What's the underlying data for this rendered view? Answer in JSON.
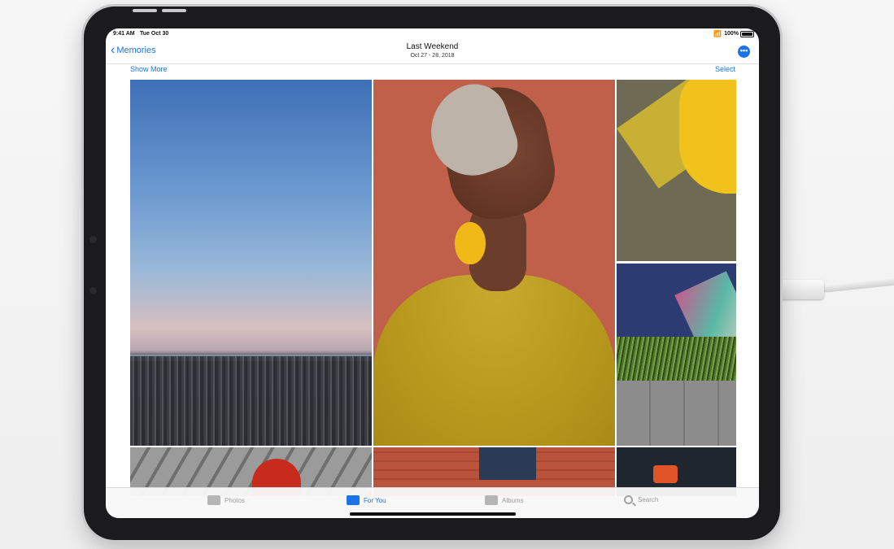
{
  "status_bar": {
    "time": "9:41 AM",
    "date": "Tue Oct 30",
    "battery": "100%"
  },
  "nav": {
    "back_label": "Memories",
    "title": "Last Weekend",
    "subtitle": "Oct 27 - 28, 2018",
    "more_icon": "ellipsis-icon"
  },
  "toolbar": {
    "show_more": "Show More",
    "select": "Select"
  },
  "tabs": [
    {
      "label": "Photos",
      "icon": "photos-icon",
      "active": false
    },
    {
      "label": "For You",
      "icon": "for-you-icon",
      "active": true
    },
    {
      "label": "Albums",
      "icon": "albums-icon",
      "active": false
    },
    {
      "label": "Search",
      "icon": "search-icon",
      "active": false
    }
  ],
  "colors": {
    "accent": "#1a73e8",
    "bezel": "#1b1b1d"
  }
}
